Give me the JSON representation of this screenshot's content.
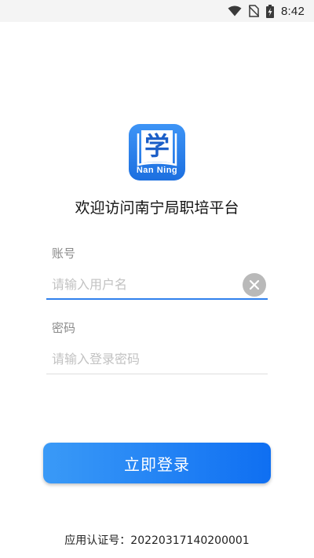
{
  "status_bar": {
    "time": "8:42",
    "icons": [
      "wifi-icon",
      "no-sim-icon",
      "battery-charging-icon"
    ]
  },
  "logo": {
    "character": "学",
    "text": "Nan Ning",
    "colors": {
      "background": "#2a82ec",
      "book": "#ffffff"
    }
  },
  "welcome_title": "欢迎访问南宁局职培平台",
  "account": {
    "label": "账号",
    "placeholder": "请输入用户名",
    "value": ""
  },
  "password": {
    "label": "密码",
    "placeholder": "请输入登录密码",
    "value": ""
  },
  "login_button": {
    "label": "立即登录"
  },
  "certificate": "应用认证号：20220317140200001",
  "colors": {
    "accent": "#2f80ed",
    "button_gradient_start": "#3a9af7",
    "button_gradient_end": "#0f6ff2"
  }
}
